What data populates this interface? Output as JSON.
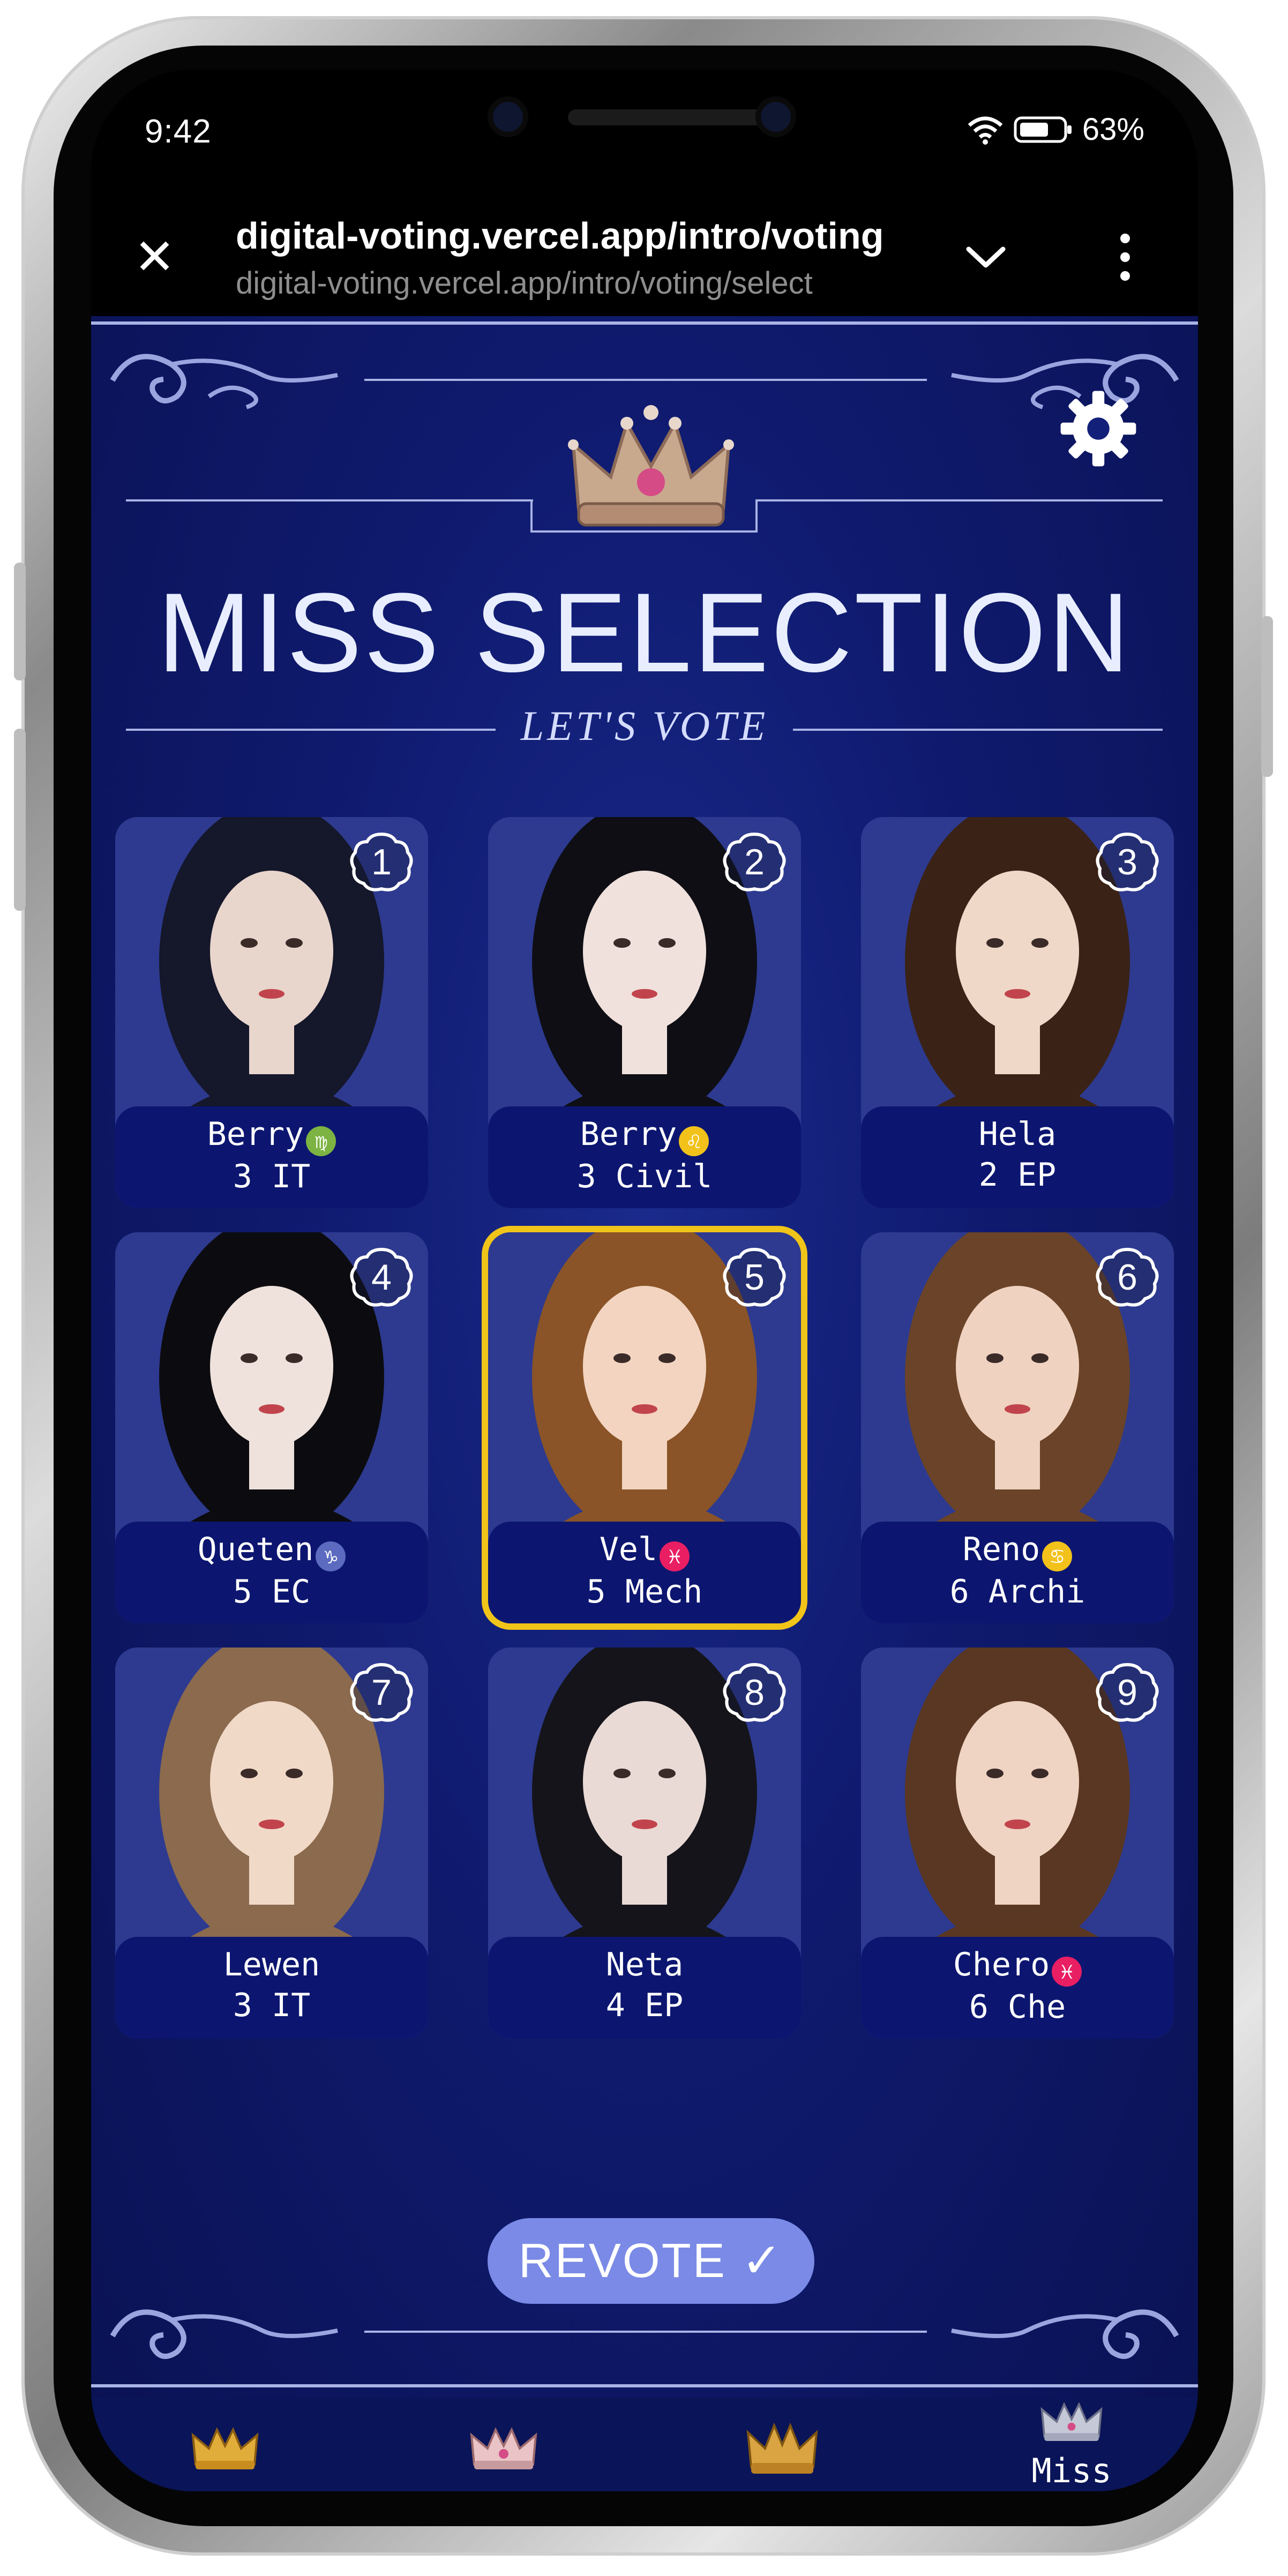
{
  "status_bar": {
    "time": "9:42",
    "battery": "63%",
    "icons": [
      "wifi-icon",
      "battery-icon"
    ]
  },
  "browser": {
    "title": "digital-voting.vercel.app/intro/voting",
    "url": "digital-voting.vercel.app/intro/voting/select",
    "icons": [
      "close-icon",
      "chevron-down-icon",
      "kebab-menu-icon"
    ]
  },
  "page": {
    "title": "MISS SELECTION",
    "subtitle": "LET'S VOTE",
    "selected_candidate": 5
  },
  "candidates": [
    {
      "number": "1",
      "name": "Berry",
      "zodiac": "virgo",
      "zodiac_symbol": "♍",
      "zodiac_color": "#7cb342",
      "detail": "3 IT"
    },
    {
      "number": "2",
      "name": "Berry",
      "zodiac": "leo",
      "zodiac_symbol": "♌",
      "zodiac_color": "#f2c21b",
      "detail": "3 Civil"
    },
    {
      "number": "3",
      "name": "Hela",
      "zodiac": "",
      "zodiac_symbol": "",
      "zodiac_color": "",
      "detail": "2 EP"
    },
    {
      "number": "4",
      "name": "Queten",
      "zodiac": "capricorn",
      "zodiac_symbol": "♑",
      "zodiac_color": "#5c6bc0",
      "detail": "5 EC"
    },
    {
      "number": "5",
      "name": "Vel",
      "zodiac": "pisces",
      "zodiac_symbol": "♓",
      "zodiac_color": "#e91e63",
      "detail": "5 Mech"
    },
    {
      "number": "6",
      "name": "Reno",
      "zodiac": "cancer",
      "zodiac_symbol": "♋",
      "zodiac_color": "#f2c21b",
      "detail": "6 Archi"
    },
    {
      "number": "7",
      "name": "Lewen",
      "zodiac": "",
      "zodiac_symbol": "",
      "zodiac_color": "",
      "detail": "3 IT"
    },
    {
      "number": "8",
      "name": "Neta",
      "zodiac": "",
      "zodiac_symbol": "",
      "zodiac_color": "",
      "detail": "4 EP"
    },
    {
      "number": "9",
      "name": "Chero",
      "zodiac": "pisces",
      "zodiac_symbol": "♓",
      "zodiac_color": "#e91e63",
      "detail": "6 Che"
    }
  ],
  "actions": {
    "revote_label": "REVOTE ✓"
  },
  "bottom_nav": {
    "items": [
      {
        "icon": "crown-gold-icon",
        "label": ""
      },
      {
        "icon": "crown-rose-icon",
        "label": ""
      },
      {
        "icon": "crown-gold-large-icon",
        "label": ""
      },
      {
        "icon": "crown-silver-icon",
        "label": "Miss"
      }
    ]
  },
  "colors": {
    "background": "#0f1a6e",
    "selected_border": "#f0c419",
    "revote_button": "#7a8ae6",
    "nameplate": "#0c1670"
  }
}
